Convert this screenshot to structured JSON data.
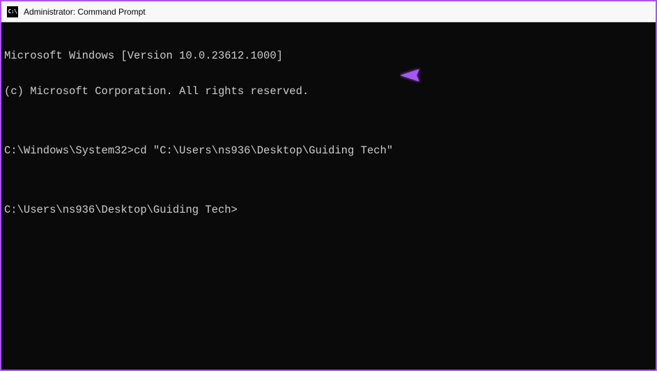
{
  "window": {
    "title": "Administrator: Command Prompt",
    "icon_label": "C:\\"
  },
  "terminal": {
    "lines": [
      "Microsoft Windows [Version 10.0.23612.1000]",
      "(c) Microsoft Corporation. All rights reserved.",
      "",
      "C:\\Windows\\System32>cd \"C:\\Users\\ns936\\Desktop\\Guiding Tech\"",
      "",
      "C:\\Users\\ns936\\Desktop\\Guiding Tech>"
    ]
  },
  "annotation": {
    "color": "#a855f7"
  }
}
